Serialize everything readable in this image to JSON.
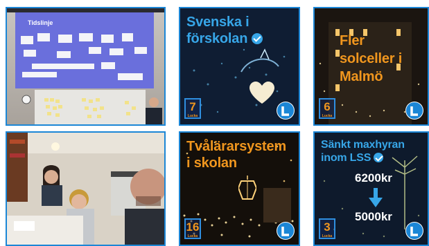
{
  "tiles": [
    {
      "kind": "photo",
      "subject": "presentation-room",
      "screen_title": "Tidslinje",
      "board_label": "Flipchart",
      "board_label_2": "Strategi"
    },
    {
      "kind": "card",
      "caption": "Svenska i förskolan",
      "verified": true,
      "badge_number": "7",
      "badge_label": "Lucka"
    },
    {
      "kind": "card",
      "caption": "Fler solceller i Malmö",
      "badge_number": "6",
      "badge_label": "Lucka"
    },
    {
      "kind": "photo",
      "subject": "office-selfie"
    },
    {
      "kind": "card",
      "caption": "Tvålärarsystem i skolan",
      "badge_number": "16",
      "badge_label": "Lucka"
    },
    {
      "kind": "card",
      "caption": "Sänkt maxhyran inom LSS",
      "verified": true,
      "price_before": "6200kr",
      "price_after": "5000kr",
      "badge_number": "3",
      "badge_label": "Lucka"
    }
  ],
  "colors": {
    "frame": "#1b86d6",
    "caption_blue": "#37a6e8",
    "caption_orange": "#f0961e",
    "night": "#0f1d33"
  },
  "icons": [
    "check-verified-icon",
    "liberalerna-logo-icon",
    "down-arrow-icon",
    "heart-icon",
    "lantern-icon"
  ]
}
